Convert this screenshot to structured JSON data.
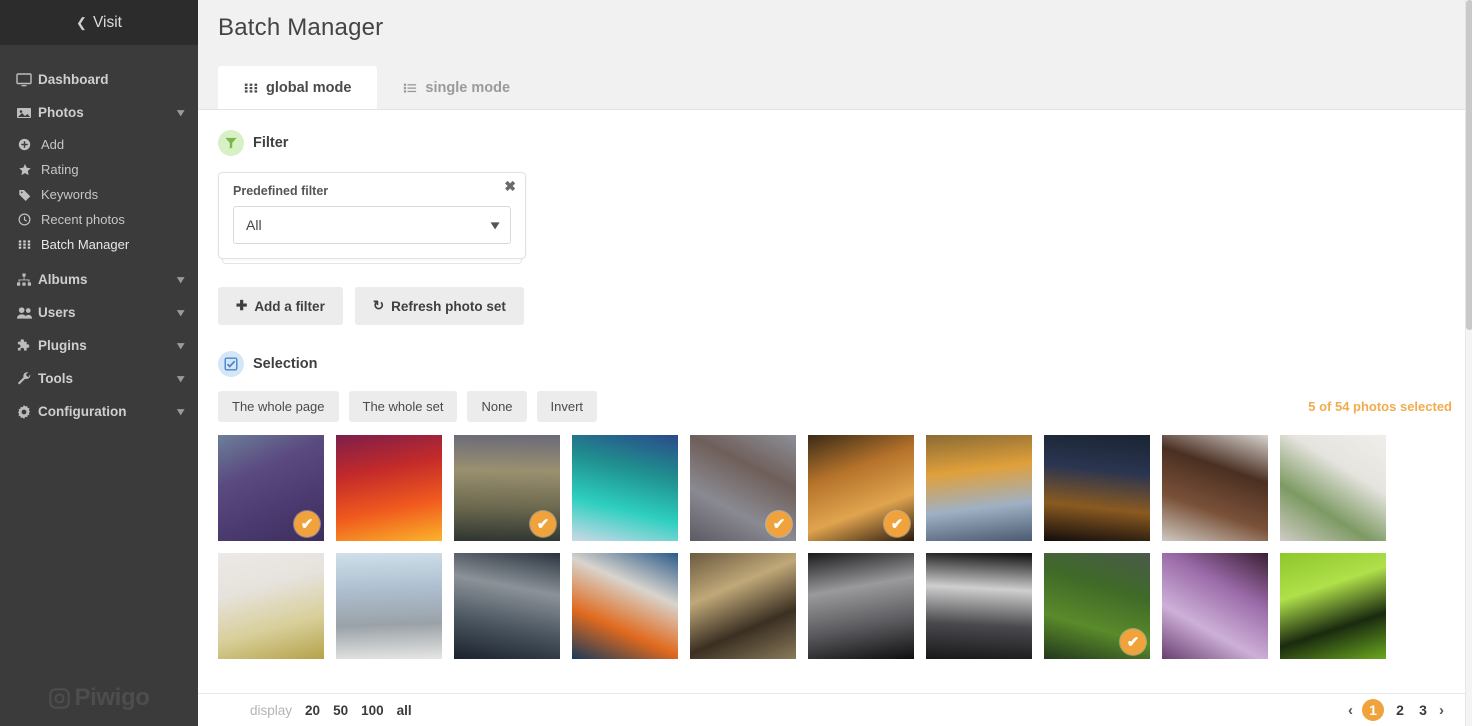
{
  "sidebar": {
    "visit": {
      "label": "Visit",
      "icon": "chevron-left-icon"
    },
    "items": [
      {
        "label": "Dashboard",
        "icon": "monitor-icon",
        "expandable": false
      },
      {
        "label": "Photos",
        "icon": "image-icon",
        "expandable": true,
        "children": [
          {
            "label": "Add",
            "icon": "plus-circle-icon",
            "active": false
          },
          {
            "label": "Rating",
            "icon": "star-icon",
            "active": false
          },
          {
            "label": "Keywords",
            "icon": "tag-icon",
            "active": false
          },
          {
            "label": "Recent photos",
            "icon": "clock-icon",
            "active": false
          },
          {
            "label": "Batch Manager",
            "icon": "grid-icon",
            "active": true
          }
        ]
      },
      {
        "label": "Albums",
        "icon": "sitemap-icon",
        "expandable": true
      },
      {
        "label": "Users",
        "icon": "users-icon",
        "expandable": true
      },
      {
        "label": "Plugins",
        "icon": "puzzle-icon",
        "expandable": true
      },
      {
        "label": "Tools",
        "icon": "wrench-icon",
        "expandable": true
      },
      {
        "label": "Configuration",
        "icon": "gear-icon",
        "expandable": true
      }
    ],
    "brand": {
      "label": "Piwigo",
      "icon": "camera-icon"
    }
  },
  "header": {
    "title": "Batch Manager",
    "tabs": [
      {
        "label": "global mode",
        "icon": "grid-icon",
        "active": true
      },
      {
        "label": "single mode",
        "icon": "list-icon",
        "active": false
      }
    ]
  },
  "filter": {
    "section_title": "Filter",
    "section_icon": "funnel-icon",
    "close_icon": "close-icon",
    "predefined_label": "Predefined filter",
    "predefined_value": "All",
    "predefined_options": [
      "All"
    ],
    "add_filter_label": "Add a filter",
    "add_filter_icon": "plus-icon",
    "refresh_label": "Refresh photo set",
    "refresh_icon": "refresh-icon"
  },
  "selection": {
    "section_title": "Selection",
    "section_icon": "checkbox-icon",
    "buttons": [
      {
        "label": "The whole page"
      },
      {
        "label": "The whole set"
      },
      {
        "label": "None"
      },
      {
        "label": "Invert"
      }
    ],
    "count_text": "5 of 54 photos selected",
    "count_color": "#f0ad4e"
  },
  "thumbnails": [
    {
      "name": "lavender-field",
      "selected": true,
      "colors": [
        "#6d7f99",
        "#5a4a80",
        "#4a3a70",
        "#3d2f5c"
      ]
    },
    {
      "name": "red-sunset-gradient",
      "selected": false,
      "colors": [
        "#7d1f4a",
        "#c32a2a",
        "#f05a1e",
        "#fbb42a"
      ]
    },
    {
      "name": "misty-lake-dusk",
      "selected": true,
      "colors": [
        "#6a6a78",
        "#9a9070",
        "#6d6a50",
        "#2f3630"
      ]
    },
    {
      "name": "aurora-borealis",
      "selected": false,
      "colors": [
        "#2b4a8a",
        "#1f8f8f",
        "#2ecfc0",
        "#cdd9e6"
      ]
    },
    {
      "name": "diamond-tile-pattern",
      "selected": true,
      "colors": [
        "#8d8f98",
        "#6f5f5a",
        "#8a8a92",
        "#5d5a63"
      ]
    },
    {
      "name": "tiger-face",
      "selected": true,
      "colors": [
        "#3a2a18",
        "#b4722a",
        "#e0a44e",
        "#2a1a10"
      ]
    },
    {
      "name": "mountain-sunrise",
      "selected": false,
      "colors": [
        "#8a6a35",
        "#e0a03a",
        "#9fb0c4",
        "#4a5a70"
      ]
    },
    {
      "name": "dark-forest-sunset",
      "selected": false,
      "colors": [
        "#1a2433",
        "#2a3550",
        "#8a5a20",
        "#120d0c"
      ]
    },
    {
      "name": "chocolate-puppy",
      "selected": false,
      "colors": [
        "#d8d4cf",
        "#4a2f22",
        "#7a5138",
        "#cfc9c2"
      ]
    },
    {
      "name": "potted-succulent",
      "selected": false,
      "colors": [
        "#f0eeea",
        "#e6e4df",
        "#7d9a63",
        "#cfcbc4"
      ]
    },
    {
      "name": "pineapple-row",
      "selected": false,
      "colors": [
        "#eceae6",
        "#e6e2dc",
        "#d8cf9a",
        "#b5a24a"
      ]
    },
    {
      "name": "pelicans-on-pier",
      "selected": false,
      "colors": [
        "#cfe0ea",
        "#aebfd0",
        "#9aa2a8",
        "#e6e6e4"
      ]
    },
    {
      "name": "stacked-barrels",
      "selected": false,
      "colors": [
        "#2a3440",
        "#8c9298",
        "#4a5560",
        "#1a222c"
      ]
    },
    {
      "name": "paint-cans",
      "selected": false,
      "colors": [
        "#2a5a8a",
        "#d8d4cd",
        "#e06a1e",
        "#1a3a5a"
      ]
    },
    {
      "name": "cathedral-hall",
      "selected": false,
      "colors": [
        "#6a5a40",
        "#c0a878",
        "#3a2f22",
        "#8a7a5a"
      ]
    },
    {
      "name": "subway-escalator",
      "selected": false,
      "colors": [
        "#1a1a1c",
        "#9a9a9c",
        "#5a5a5e",
        "#0f0f10"
      ]
    },
    {
      "name": "metro-tunnel",
      "selected": false,
      "colors": [
        "#0d0d0f",
        "#cfcfcf",
        "#4a4a4e",
        "#18181a"
      ]
    },
    {
      "name": "dewy-grass",
      "selected": true,
      "colors": [
        "#4a5a4a",
        "#3f6a28",
        "#5a8a2a",
        "#22381c"
      ]
    },
    {
      "name": "lilac-blossoms",
      "selected": false,
      "colors": [
        "#3a1f33",
        "#9a6aa8",
        "#cdb0d8",
        "#6a3f70"
      ]
    },
    {
      "name": "green-leaves-dew",
      "selected": false,
      "colors": [
        "#8ec72a",
        "#b0e04a",
        "#1a2a0f",
        "#6aa81f"
      ]
    }
  ],
  "footer": {
    "display_label": "display",
    "display_options": [
      {
        "label": "20",
        "active": false
      },
      {
        "label": "50",
        "active": false
      },
      {
        "label": "100",
        "active": true
      },
      {
        "label": "all",
        "active": false
      }
    ],
    "pagination": {
      "prev_icon": "chevron-left-icon",
      "next_icon": "chevron-right-icon",
      "pages": [
        {
          "label": "1",
          "active": true
        },
        {
          "label": "2",
          "active": false
        },
        {
          "label": "3",
          "active": false
        }
      ]
    }
  }
}
